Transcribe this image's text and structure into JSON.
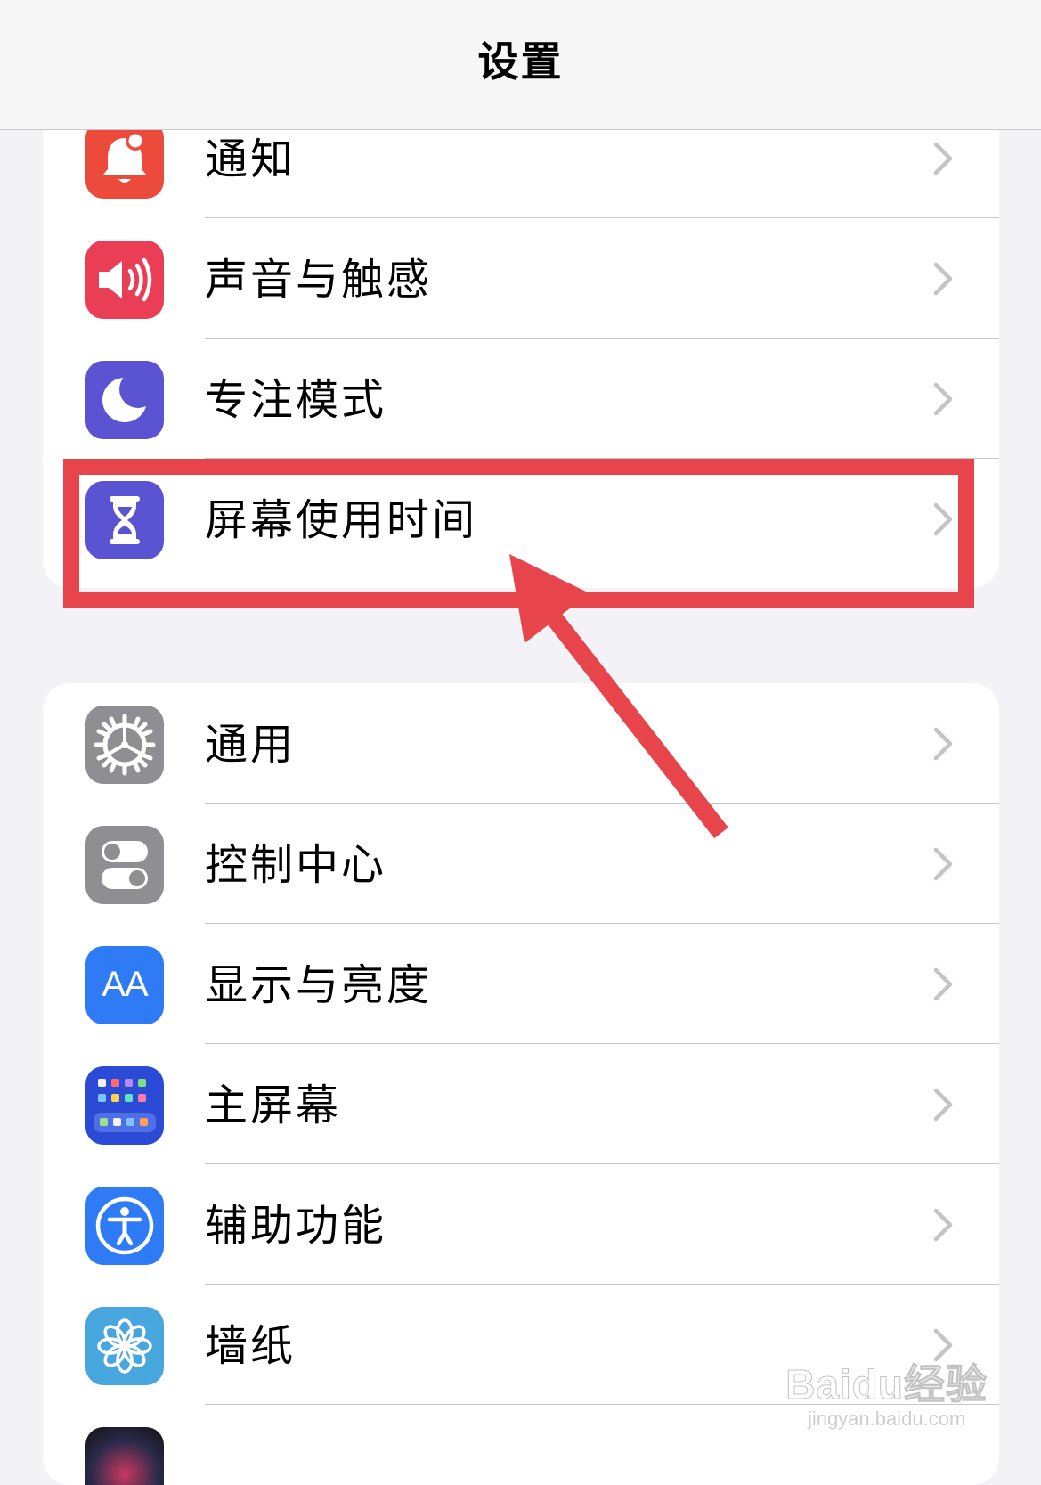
{
  "nav": {
    "title": "设置"
  },
  "colors": {
    "annotation": "#e8444c",
    "notifications": "#ec4b3c",
    "sounds": "#ea3e57",
    "focus": "#5a54d2",
    "screen_time": "#5a54d2",
    "general": "#8e8e93",
    "control_center": "#8e8e93",
    "display": "#2f7af5",
    "home_screen": "#2b4bd6",
    "accessibility": "#2f7af5",
    "wallpaper": "#48a6de"
  },
  "group1": {
    "items": [
      {
        "label": "通知",
        "icon": "bell-icon"
      },
      {
        "label": "声音与触感",
        "icon": "speaker-icon"
      },
      {
        "label": "专注模式",
        "icon": "moon-icon"
      },
      {
        "label": "屏幕使用时间",
        "icon": "hourglass-icon"
      }
    ]
  },
  "group2": {
    "items": [
      {
        "label": "通用",
        "icon": "gear-icon"
      },
      {
        "label": "控制中心",
        "icon": "toggles-icon"
      },
      {
        "label": "显示与亮度",
        "icon": "text-size-icon",
        "icon_text": "AA"
      },
      {
        "label": "主屏幕",
        "icon": "app-grid-icon"
      },
      {
        "label": "辅助功能",
        "icon": "accessibility-icon"
      },
      {
        "label": "墙纸",
        "icon": "flower-icon"
      }
    ]
  },
  "watermark": {
    "brand": "Baidu经验",
    "url": "jingyan.baidu.com"
  }
}
